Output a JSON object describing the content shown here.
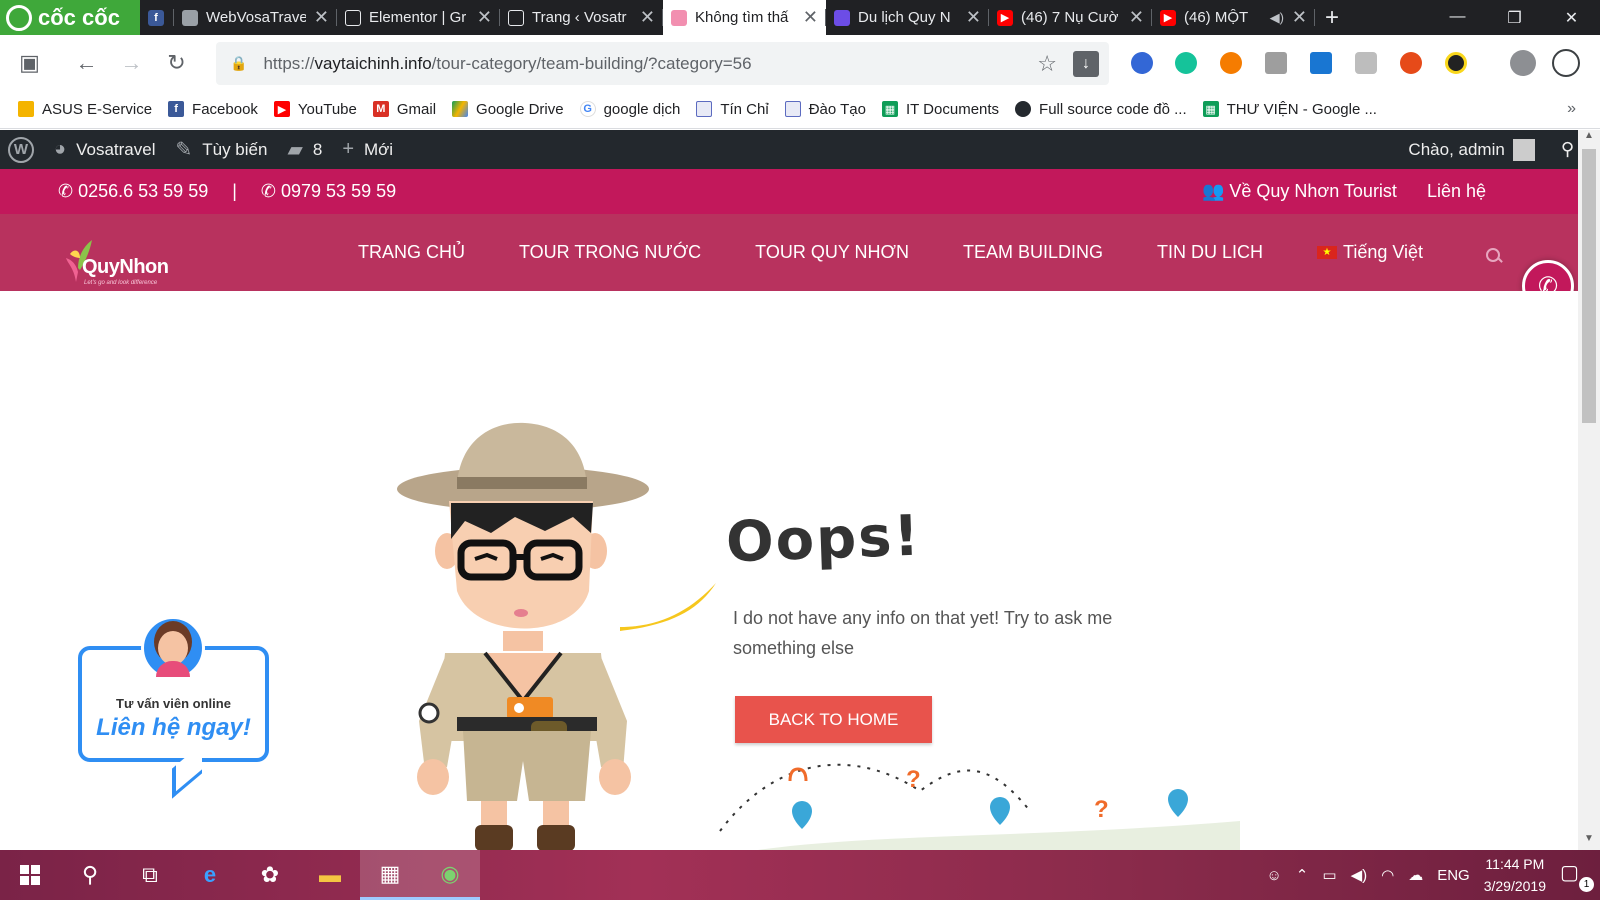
{
  "browser": {
    "brand": "cốc cốc",
    "tabs": [
      {
        "title": "",
        "favicon": "facebook-icon",
        "pinned": true
      },
      {
        "title": "WebVosaTrave",
        "favicon": "page-icon"
      },
      {
        "title": "Elementor | Gr",
        "favicon": "document-icon"
      },
      {
        "title": "Trang ‹ Vosatr",
        "favicon": "document-icon"
      },
      {
        "title": "Không tìm thấ",
        "favicon": "site-icon",
        "active": true
      },
      {
        "title": "Du lịch Quy N",
        "favicon": "site-icon"
      },
      {
        "title": "(46) 7 Nụ Cườ",
        "favicon": "youtube-icon"
      },
      {
        "title": "(46) MỘT",
        "favicon": "youtube-icon",
        "audio": true
      }
    ],
    "address": {
      "host": "vaytaichinh.info",
      "scheme": "https://",
      "path": "/tour-category/team-building/?category=56"
    },
    "bookmarks": [
      {
        "label": "ASUS E-Service",
        "icon": "folder-icon"
      },
      {
        "label": "Facebook",
        "icon": "facebook-icon"
      },
      {
        "label": "YouTube",
        "icon": "youtube-icon"
      },
      {
        "label": "Gmail",
        "icon": "gmail-icon"
      },
      {
        "label": "Google Drive",
        "icon": "drive-icon"
      },
      {
        "label": "google dịch",
        "icon": "google-icon"
      },
      {
        "label": "Tín Chỉ",
        "icon": "document-icon"
      },
      {
        "label": "Đào Tạo",
        "icon": "document-icon"
      },
      {
        "label": "IT Documents",
        "icon": "sheets-icon"
      },
      {
        "label": "Full source code đồ ...",
        "icon": "github-icon"
      },
      {
        "label": "THƯ VIỆN - Google ...",
        "icon": "sheets-icon"
      }
    ]
  },
  "wpadmin": {
    "site": "Vosatravel",
    "customize": "Tùy biến",
    "comments": "8",
    "new": "Mới",
    "greeting": "Chào, admin"
  },
  "site": {
    "phone1": "0256.6 53 59 59",
    "separator": "|",
    "phone2": "0979 53 59 59",
    "about": "Về Quy Nhơn Tourist",
    "contact": "Liên hệ",
    "logo": {
      "name": "QuyNhon",
      "slogan": "Let's go and look difference"
    },
    "menu": [
      "TRANG CHỦ",
      "TOUR TRONG NƯỚC",
      "TOUR QUY NHƠN",
      "TEAM BUILDING",
      "TIN DU LICH"
    ],
    "language": "Tiếng Việt",
    "colors": {
      "primary": "#c2185b",
      "nav": "#b8325e",
      "button": "#e8534c",
      "chat": "#2f8ef3"
    }
  },
  "error": {
    "heading": "Oops!",
    "message": "I do not have any info on that yet! Try to ask me something else",
    "button": "BACK TO HOME"
  },
  "chat": {
    "line1": "Tư vấn viên online",
    "line2": "Liên hệ ngay!"
  },
  "taskbar": {
    "language": "ENG",
    "time": "11:44 PM",
    "date": "3/29/2019",
    "notifications": "1"
  }
}
